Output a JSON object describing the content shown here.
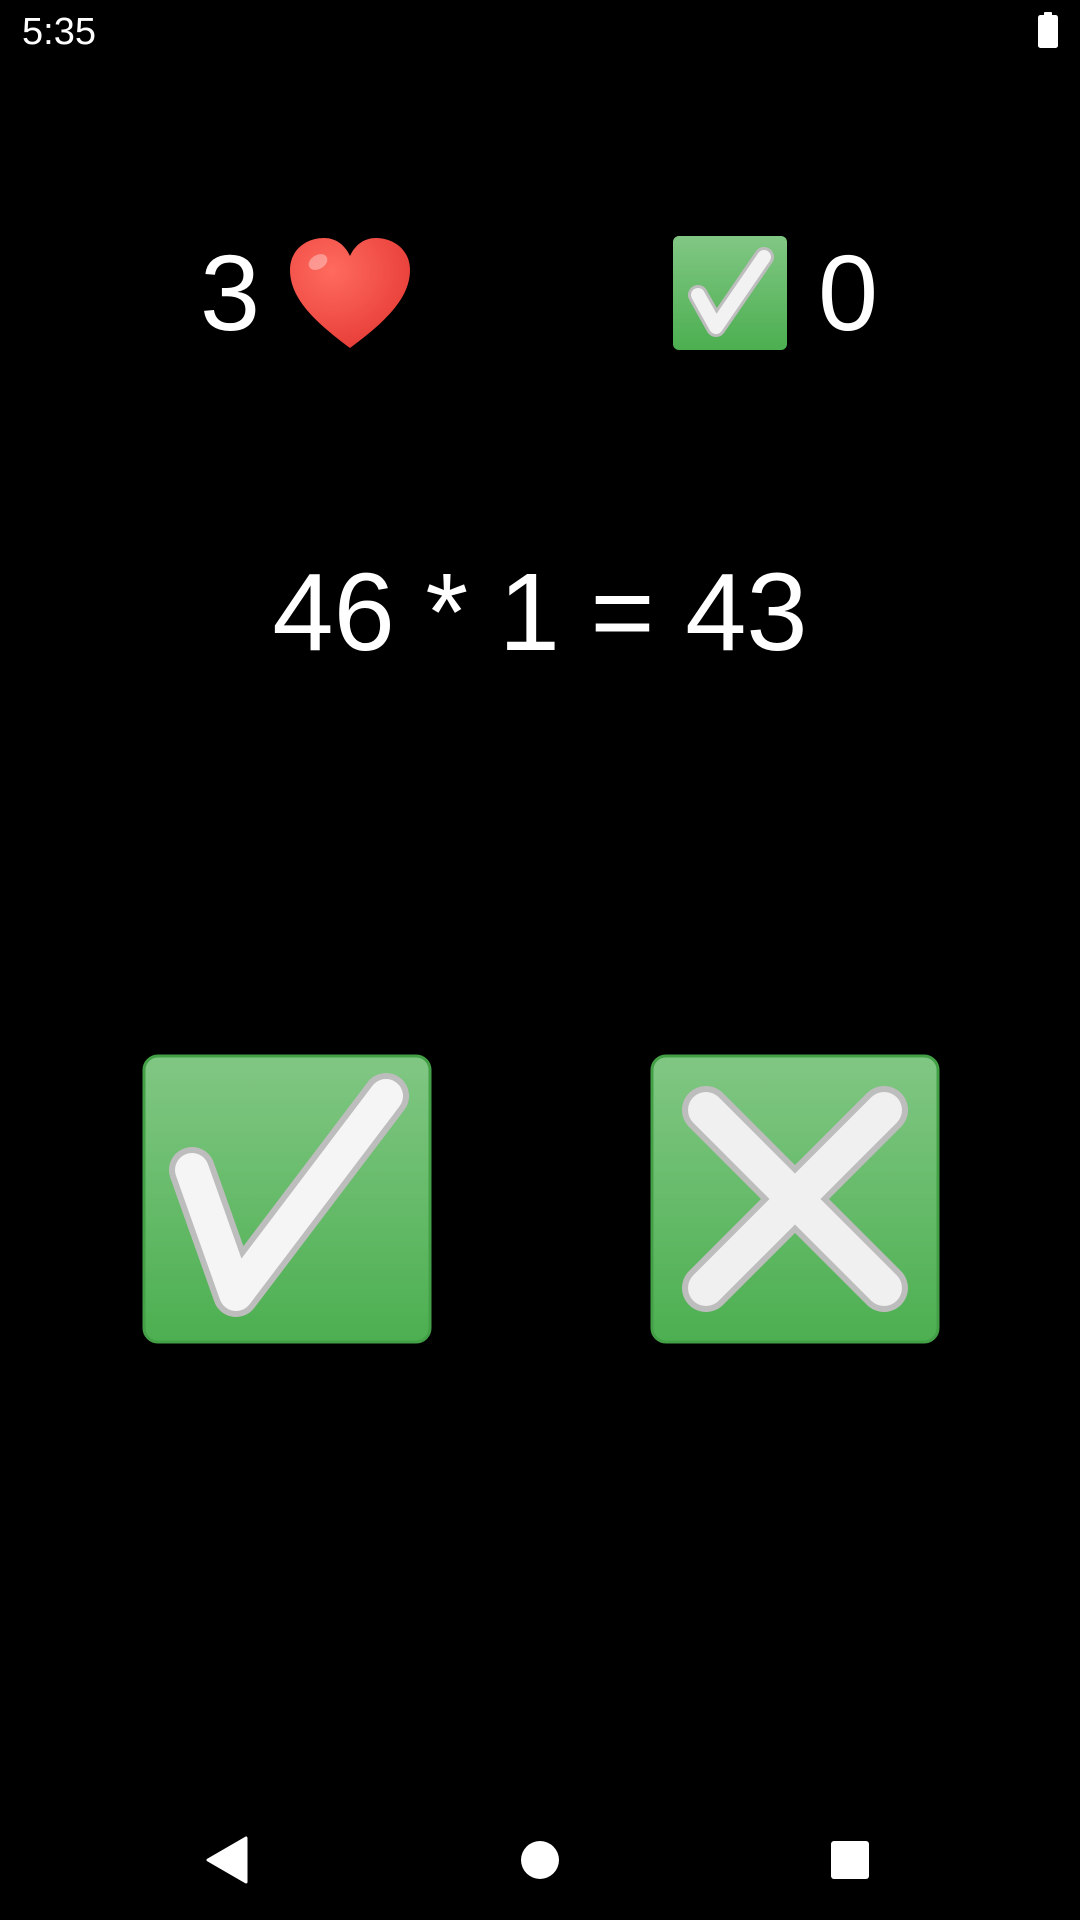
{
  "status_bar": {
    "time": "5:35",
    "battery_icon": "battery-full-icon"
  },
  "score": {
    "lives": "3",
    "lives_icon": "heart-icon",
    "correct": "0",
    "correct_icon": "check-mark-button-icon"
  },
  "question": {
    "equation": "46 * 1 = 43"
  },
  "answers": {
    "true_icon": "check-mark-button-icon",
    "false_icon": "cross-mark-button-icon"
  },
  "nav_bar": {
    "back_icon": "back-triangle-icon",
    "home_icon": "home-circle-icon",
    "recents_icon": "recents-square-icon"
  },
  "colors": {
    "background": "#000000",
    "text": "#ffffff",
    "heart": "#f44336",
    "button_green_top": "#81c784",
    "button_green_bottom": "#4caf50",
    "glyph_white": "#eeeeee"
  }
}
